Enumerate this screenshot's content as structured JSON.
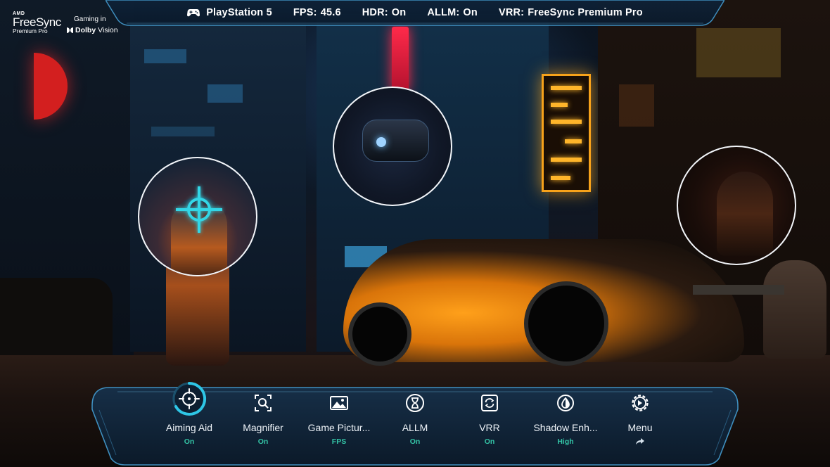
{
  "branding": {
    "freesync": {
      "brand": "AMD",
      "name": "FreeSync",
      "tier": "Premium Pro"
    },
    "dolby": {
      "prefix": "Gaming in",
      "name": "Dolby",
      "suffix": "Vision"
    }
  },
  "status_bar": {
    "source": {
      "icon": "gamepad-icon",
      "label": "PlayStation 5"
    },
    "fps": {
      "label": "FPS:",
      "value": "45.6"
    },
    "hdr": {
      "label": "HDR:",
      "value": "On"
    },
    "allm": {
      "label": "ALLM:",
      "value": "On"
    },
    "vrr": {
      "label": "VRR:",
      "value": "FreeSync Premium Pro"
    }
  },
  "game_bar": {
    "items": [
      {
        "icon": "crosshair-icon",
        "label": "Aiming Aid",
        "value": "On",
        "active": true
      },
      {
        "icon": "magnifier-icon",
        "label": "Magnifier",
        "value": "On",
        "active": false
      },
      {
        "icon": "picture-icon",
        "label": "Game Pictur...",
        "value": "FPS",
        "active": false
      },
      {
        "icon": "hourglass-icon",
        "label": "ALLM",
        "value": "On",
        "active": false
      },
      {
        "icon": "refresh-icon",
        "label": "VRR",
        "value": "On",
        "active": false
      },
      {
        "icon": "shadow-icon",
        "label": "Shadow Enh...",
        "value": "High",
        "active": false
      },
      {
        "icon": "settings-icon",
        "label": "Menu",
        "value": "",
        "active": false,
        "action_icon": "arrow-forward-icon"
      }
    ]
  },
  "colors": {
    "accent_cyan": "#34c4d6",
    "status_on_green": "#34c4a6",
    "panel_bg": "#0e2236",
    "panel_border": "#3f8fbf"
  }
}
